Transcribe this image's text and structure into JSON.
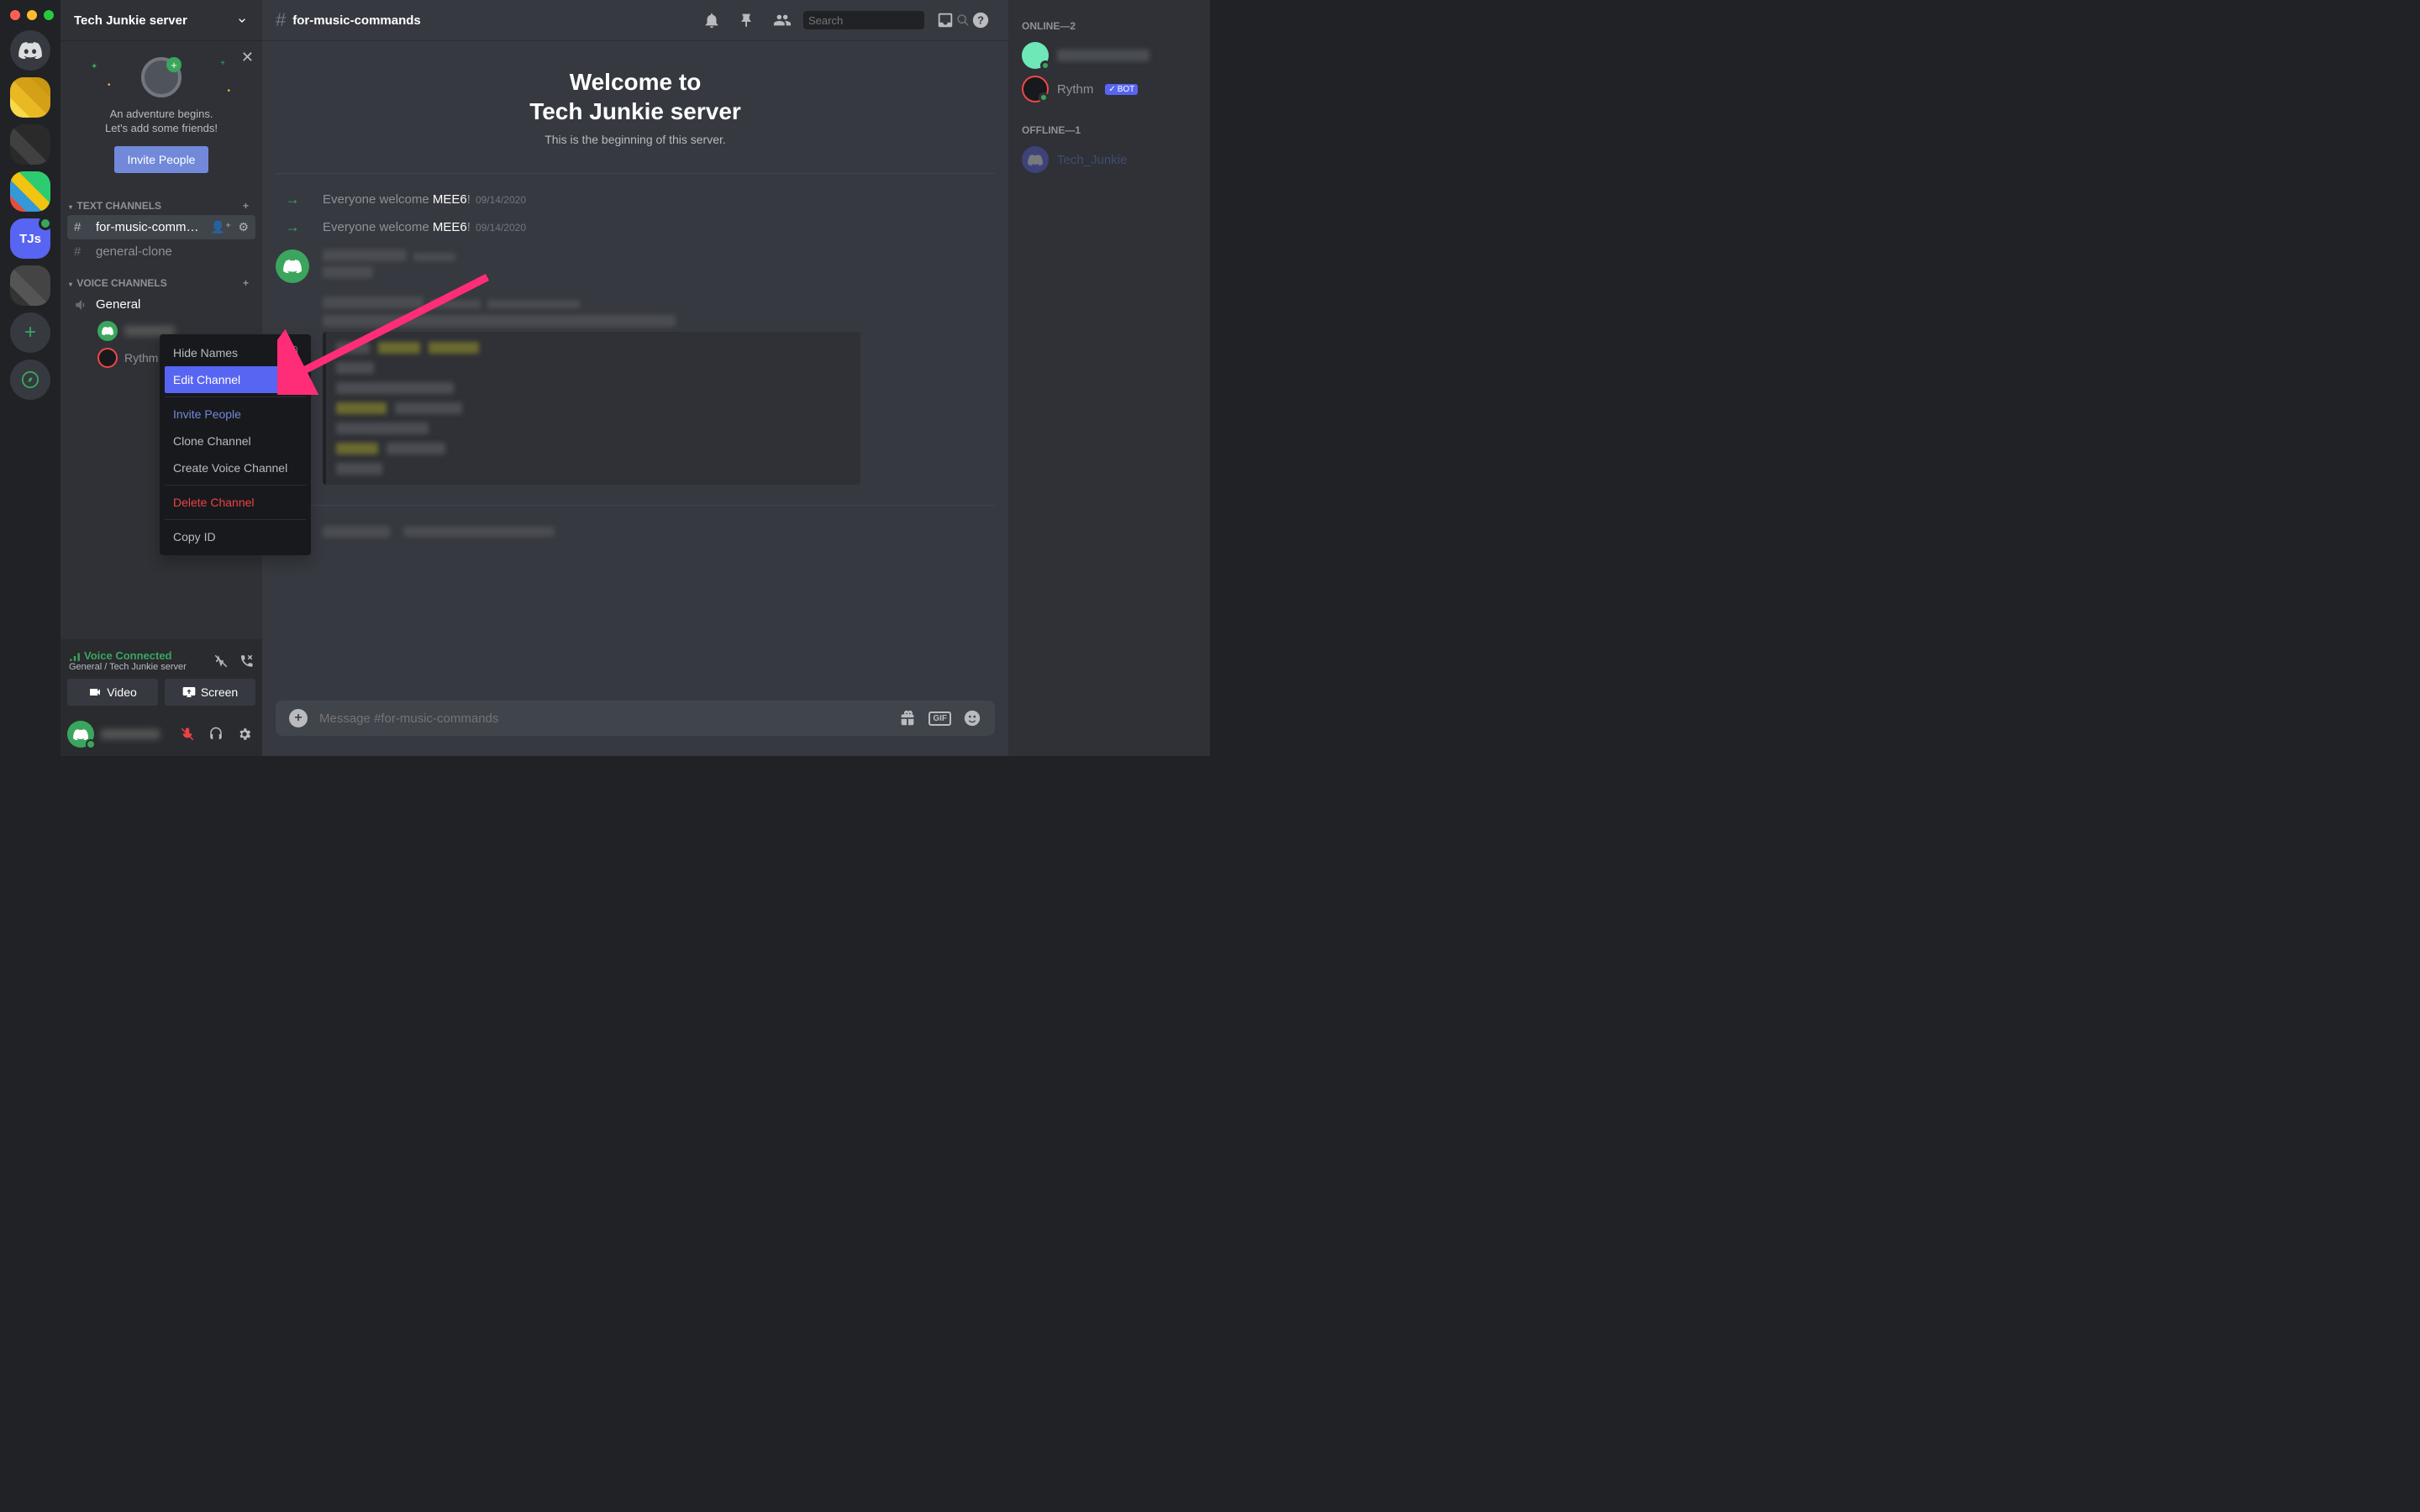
{
  "server": {
    "name": "Tech Junkie server",
    "selected_label": "TJs"
  },
  "invite_card": {
    "line1": "An adventure begins.",
    "line2": "Let's add some friends!",
    "button": "Invite People"
  },
  "channel_categories": {
    "text": {
      "label": "TEXT CHANNELS"
    },
    "voice": {
      "label": "VOICE CHANNELS"
    }
  },
  "text_channels": [
    {
      "name": "for-music-comman...",
      "active": true
    },
    {
      "name": "general-clone",
      "active": false
    }
  ],
  "voice_channels": [
    {
      "name": "General",
      "members": [
        {
          "name_blurred": true
        },
        {
          "name": "Rythm"
        }
      ]
    }
  ],
  "voice_panel": {
    "status": "Voice Connected",
    "sub": "General / Tech Junkie server",
    "video": "Video",
    "screen": "Screen"
  },
  "topbar": {
    "channel": "for-music-commands",
    "search_placeholder": "Search"
  },
  "welcome": {
    "title_l1": "Welcome to",
    "title_l2": "Tech Junkie server",
    "subtitle": "This is the beginning of this server."
  },
  "system_messages": [
    {
      "prefix": "Everyone welcome ",
      "user": "MEE6",
      "suffix": "!",
      "ts": "09/14/2020"
    },
    {
      "prefix": "Everyone welcome ",
      "user": "MEE6",
      "suffix": "!",
      "ts": "09/14/2020"
    }
  ],
  "composer": {
    "placeholder": "Message #for-music-commands"
  },
  "members_panel": {
    "online_label": "ONLINE—2",
    "offline_label": "OFFLINE—1",
    "online": [
      {
        "name_blurred": true,
        "color": "#6fe8b8"
      },
      {
        "name": "Rythm",
        "bot": true,
        "color": "#18191c"
      }
    ],
    "offline": [
      {
        "name": "Tech_Junkie",
        "color": "#5865f2"
      }
    ]
  },
  "context_menu": {
    "items": [
      {
        "label": "Hide Names",
        "type": "check"
      },
      {
        "label": "Edit Channel",
        "type": "highlight"
      },
      {
        "label": "Invite People",
        "type": "link",
        "sep_before": true
      },
      {
        "label": "Clone Channel",
        "type": "normal"
      },
      {
        "label": "Create Voice Channel",
        "type": "normal"
      },
      {
        "label": "Delete Channel",
        "type": "danger",
        "sep_before": true
      },
      {
        "label": "Copy ID",
        "type": "normal",
        "sep_before": true
      }
    ]
  },
  "bot_badge": "BOT"
}
